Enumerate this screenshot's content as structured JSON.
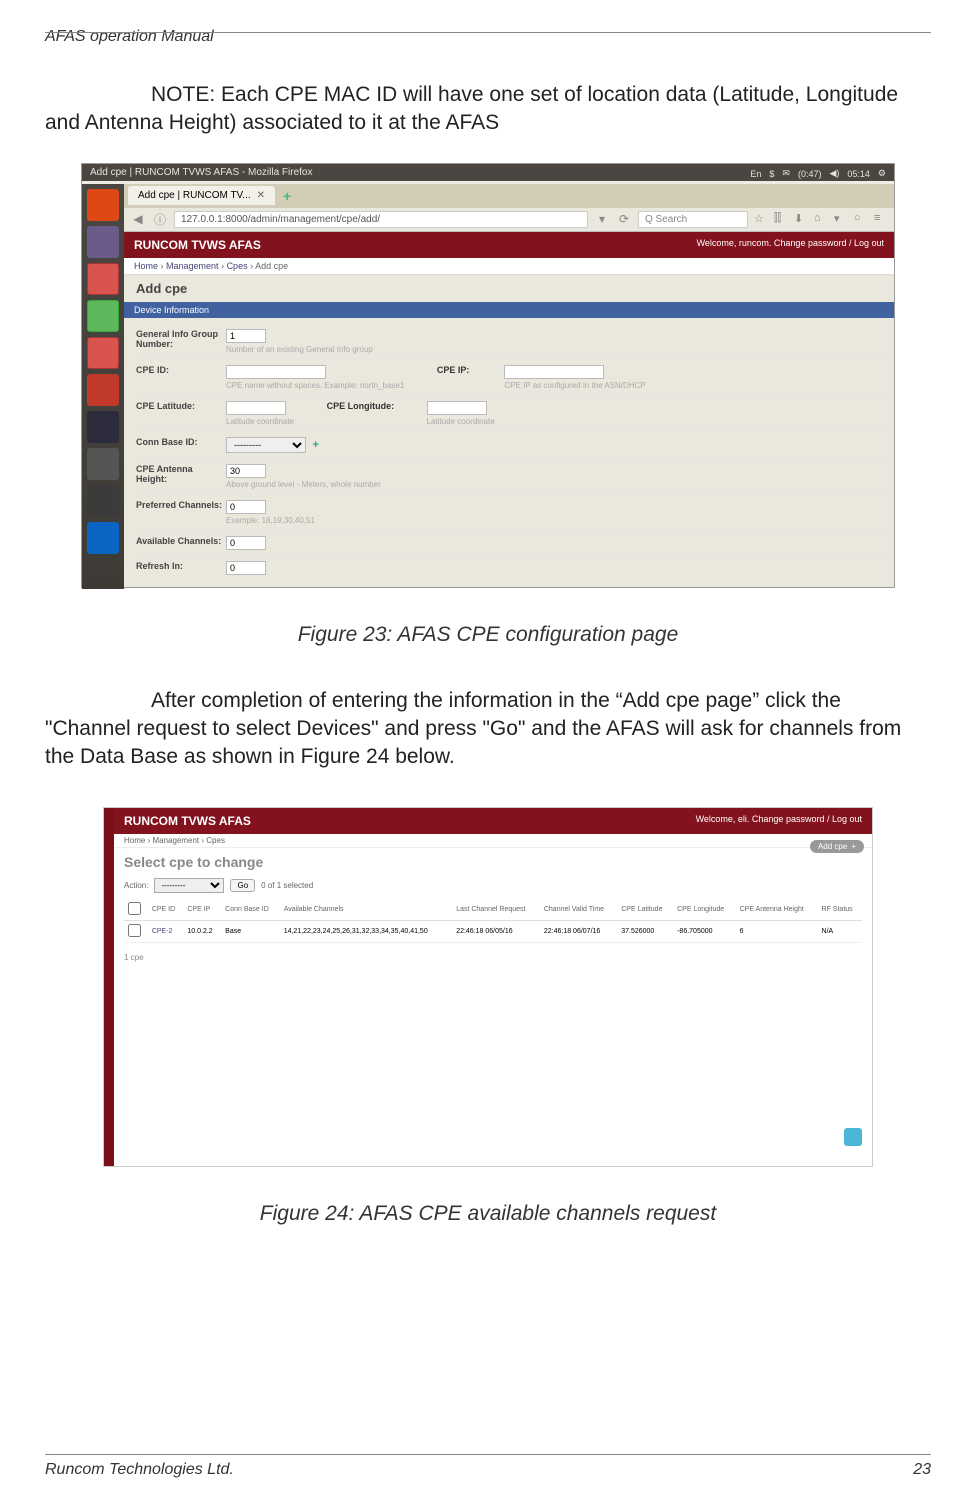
{
  "header": {
    "title": "AFAS operation Manual"
  },
  "note_text": "NOTE: Each CPE MAC ID will have one set of location data (Latitude, Longitude and Antenna Height) associated to it at the AFAS",
  "figure23_caption": "Figure 23: AFAS CPE configuration page",
  "body_text": "After completion of entering the information in the “Add cpe page” click the \"Channel request to select Devices\" and press \"Go\" and the AFAS will ask for channels from the Data Base as shown in Figure 24 below.",
  "figure24_caption": "Figure 24: AFAS CPE available channels request",
  "footer": {
    "left": "Runcom Technologies Ltd.",
    "right": "23"
  },
  "screenshot1": {
    "window_title": "Add cpe | RUNCOM TVWS AFAS - Mozilla Firefox",
    "status_right": {
      "lang": "En",
      "bt": "$",
      "mail": "✉",
      "battery": "(0:47)",
      "sound": "◀)",
      "time": "05:14"
    },
    "tab_label": "Add cpe | RUNCOM TV...",
    "url": "127.0.0.1:8000/admin/management/cpe/add/",
    "search_placeholder": "Search",
    "app_title": "RUNCOM TVWS AFAS",
    "welcome": "Welcome, runcom. Change password / Log out",
    "breadcrumb_home": "Home",
    "breadcrumb_mgmt": "Management",
    "breadcrumb_cpes": "Cpes",
    "breadcrumb_add": "Add cpe",
    "page_heading": "Add cpe",
    "section": "Device Information",
    "fields": {
      "gin_label": "General Info Group Number:",
      "gin_value": "1",
      "gin_hint": "Number of an existing General Info group",
      "cpeid_label": "CPE ID:",
      "cpeid_hint": "CPE name without spaces. Example: north_base1",
      "cpeip_label": "CPE IP:",
      "cpeip_hint": "CPE IP as configured in the ASN/DHCP",
      "lat_label": "CPE Latitude:",
      "lat_hint": "Latitude coordinate",
      "lon_label": "CPE Longitude:",
      "lon_hint": "Latitude coordinate",
      "conn_label": "Conn Base ID:",
      "conn_value": "---------",
      "ant_label": "CPE Antenna Height:",
      "ant_value": "30",
      "ant_hint": "Above ground level - Meters, whole number",
      "pref_label": "Preferred Channels:",
      "pref_value": "0",
      "pref_hint": "Example: 18,19,30,40,51",
      "avail_label": "Available Channels:",
      "avail_value": "0",
      "refresh_label": "Refresh In:",
      "refresh_value": "0"
    }
  },
  "screenshot2": {
    "app_title": "RUNCOM TVWS AFAS",
    "welcome": "Welcome, eli. Change password / Log out",
    "breadcrumb_home": "Home",
    "breadcrumb_mgmt": "Management",
    "breadcrumb_cpes": "Cpes",
    "heading": "Select cpe to change",
    "add_btn": "Add cpe",
    "action_label": "Action:",
    "action_value": "---------",
    "go_label": "Go",
    "selected": "0 of 1 selected",
    "headers": [
      "CPE ID",
      "CPE IP",
      "Conn Base ID",
      "Available Channels",
      "Last Channel Request",
      "Channel Valid Time",
      "CPE Latitude",
      "CPE Longitude",
      "CPE Antenna Height",
      "RF Status"
    ],
    "row": {
      "id": "CPE-2",
      "ip": "10.0.2.2",
      "base": "Base",
      "channels": "14,21,22,23,24,25,26,31,32,33,34,35,40,41,50",
      "last": "22:46:18 06/05/16",
      "valid": "22:46:18 06/07/16",
      "lat": "37.526000",
      "lon": "-86.705000",
      "ant": "6",
      "rf": "N/A"
    },
    "count": "1 cpe"
  }
}
